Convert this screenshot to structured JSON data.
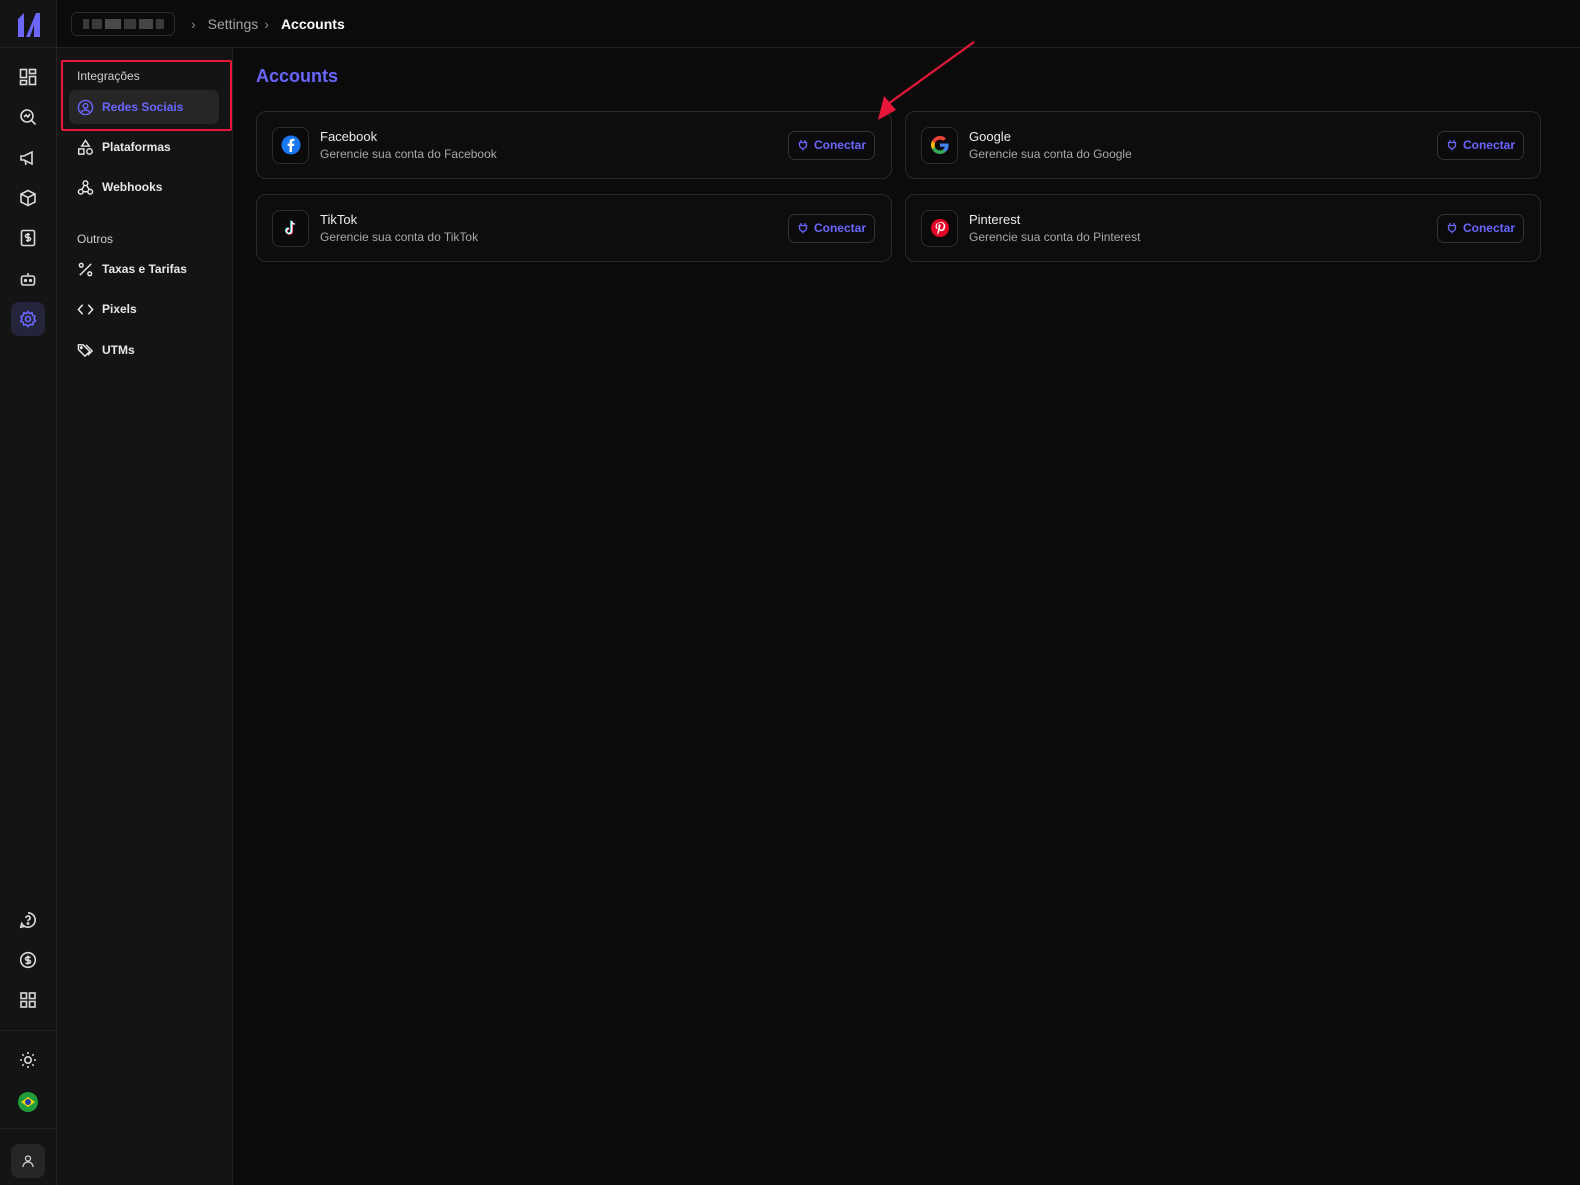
{
  "breadcrumb": {
    "items": [
      "Settings",
      "Accounts"
    ]
  },
  "subnav": {
    "groups": [
      {
        "label": "Integrações",
        "items": [
          "Redes Sociais",
          "Plataformas",
          "Webhooks"
        ]
      },
      {
        "label": "Outros",
        "items": [
          "Taxas e Tarifas",
          "Pixels",
          "UTMs"
        ]
      }
    ],
    "active_item": "Redes Sociais"
  },
  "main": {
    "title": "Accounts",
    "cards": [
      {
        "name": "Facebook",
        "description": "Gerencie sua conta do Facebook",
        "action": "Conectar",
        "icon": "facebook-icon",
        "color": "#1877f2"
      },
      {
        "name": "Google",
        "description": "Gerencie sua conta do Google",
        "action": "Conectar",
        "icon": "google-icon",
        "color": "#4285f4"
      },
      {
        "name": "TikTok",
        "description": "Gerencie sua conta do TikTok",
        "action": "Conectar",
        "icon": "tiktok-icon",
        "color": "#ffffff"
      },
      {
        "name": "Pinterest",
        "description": "Gerencie sua conta do Pinterest",
        "action": "Conectar",
        "icon": "pinterest-icon",
        "color": "#e60023"
      }
    ]
  },
  "colors": {
    "accent": "#6a66ff",
    "annotation": "#e8173a",
    "background": "#0b0b0b"
  },
  "rail_icons": [
    "dashboard-icon",
    "search-analytics-icon",
    "megaphone-icon",
    "package-icon",
    "invoice-icon",
    "bot-icon",
    "settings-icon",
    "help-chat-icon",
    "dollar-icon",
    "apps-grid-icon",
    "sun-icon",
    "brazil-flag-icon",
    "user-icon"
  ]
}
